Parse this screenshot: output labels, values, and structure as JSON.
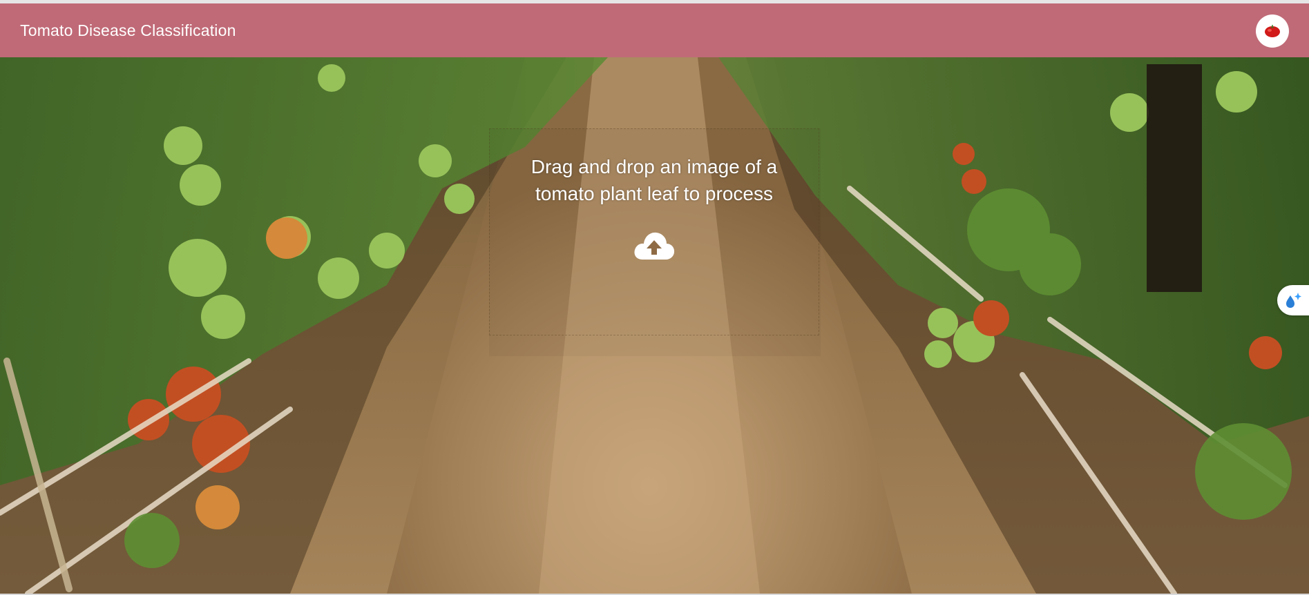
{
  "app": {
    "title": "Tomato Disease Classification",
    "brand_color": "#c06a77"
  },
  "header": {
    "logo_icon": "tomato-icon"
  },
  "dropzone": {
    "line1": "Drag and drop an image of a",
    "line2": "tomato plant leaf to process",
    "icon": "cloud-upload-icon"
  },
  "side_widget": {
    "icon": "sparkle-drop-icon"
  },
  "background": {
    "description_icon": "tomato-field-photo"
  }
}
